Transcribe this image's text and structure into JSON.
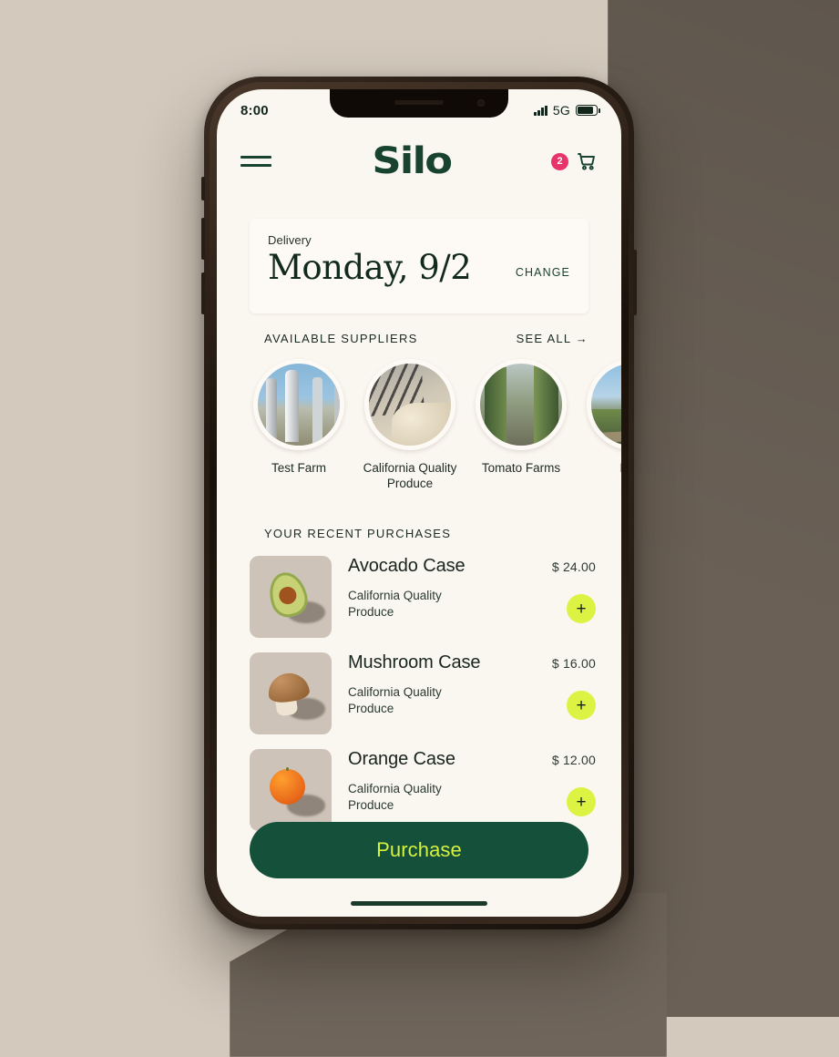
{
  "status_bar": {
    "time": "8:00",
    "network": "5G",
    "signal_icon": "signal-bars-icon",
    "battery_icon": "battery-icon"
  },
  "header": {
    "menu_icon": "hamburger-menu-icon",
    "logo": "Silo",
    "cart_icon": "shopping-cart-icon",
    "cart_count": "2"
  },
  "delivery": {
    "label": "Delivery",
    "date": "Monday, 9/2",
    "change_label": "CHANGE"
  },
  "suppliers_section": {
    "title": "AVAILABLE SUPPLIERS",
    "see_all": "SEE ALL →",
    "items": [
      {
        "name": "Test Farm",
        "image": "silo-tanks-photo"
      },
      {
        "name": "California Quality Produce",
        "image": "conveyor-belt-photo"
      },
      {
        "name": "Tomato Farms",
        "image": "greenhouse-rows-photo"
      },
      {
        "name": "Rive",
        "image": "river-landscape-photo"
      }
    ]
  },
  "purchases_section": {
    "title": "YOUR RECENT PURCHASES",
    "items": [
      {
        "name": "Avocado Case",
        "supplier": "California Quality Produce",
        "price": "$ 24.00",
        "image": "avocado-photo",
        "add_label": "+"
      },
      {
        "name": "Mushroom Case",
        "supplier": "California Quality Produce",
        "price": "$ 16.00",
        "image": "mushroom-photo",
        "add_label": "+"
      },
      {
        "name": "Orange Case",
        "supplier": "California Quality Produce",
        "price": "$ 12.00",
        "image": "orange-photo",
        "add_label": "+"
      }
    ]
  },
  "cta": {
    "label": "Purchase"
  },
  "colors": {
    "brand_green": "#17432f",
    "cta_green": "#14503a",
    "lime": "#dcf344",
    "badge_pink": "#e8346b",
    "screen_bg": "#faf6f0",
    "card_bg": "#fdfaf6",
    "page_bg": "#d3c9bd",
    "shadow": "#6a6056"
  }
}
